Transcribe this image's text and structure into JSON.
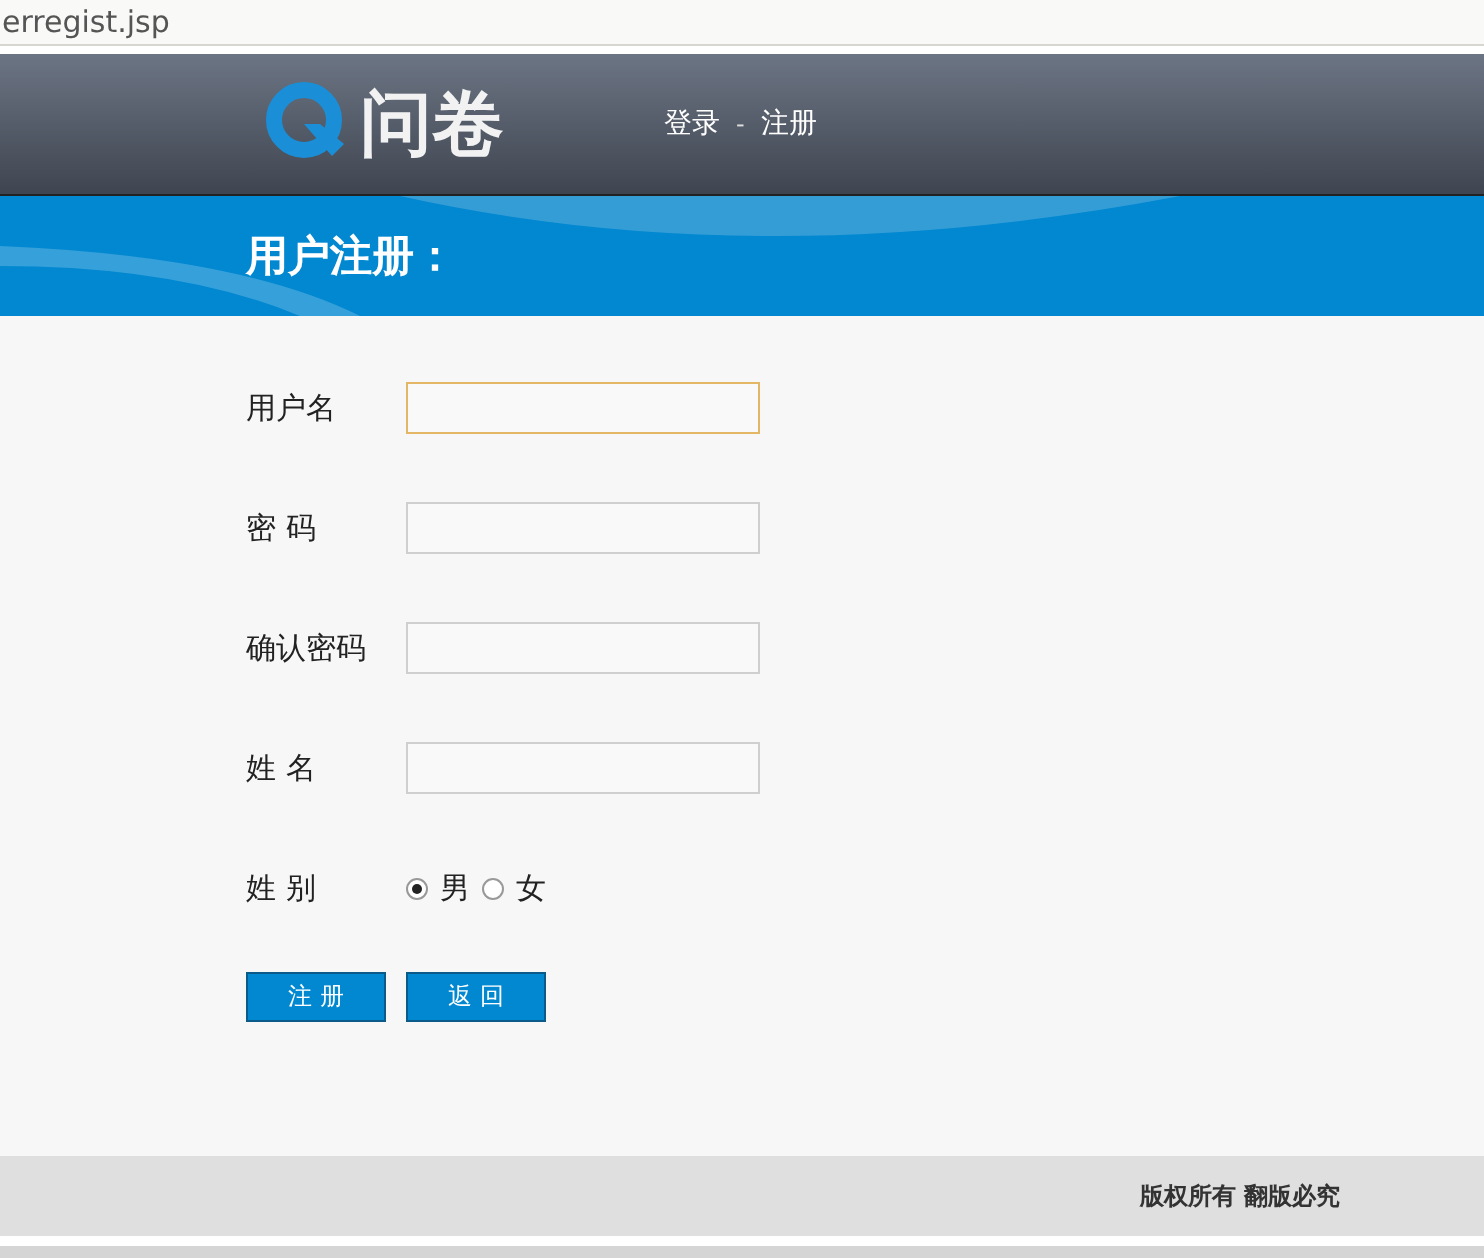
{
  "address_bar": {
    "url": "erregist.jsp"
  },
  "header": {
    "logo_text": "问卷",
    "nav": [
      {
        "label": "登录"
      },
      {
        "label": "注册"
      }
    ],
    "nav_separator": "-"
  },
  "banner": {
    "title": "用户注册："
  },
  "form": {
    "fields": [
      {
        "kind": "text",
        "label": "用户名",
        "focused": true
      },
      {
        "kind": "text",
        "label": "密 码",
        "focused": false
      },
      {
        "kind": "text",
        "label": "确认密码",
        "focused": false
      },
      {
        "kind": "text",
        "label": "姓 名",
        "focused": false
      },
      {
        "kind": "radio",
        "label": "姓 别",
        "options": [
          {
            "label": "男",
            "selected": true
          },
          {
            "label": "女",
            "selected": false
          }
        ]
      }
    ],
    "buttons": [
      {
        "label": "注 册"
      },
      {
        "label": "返 回"
      }
    ]
  },
  "footer": {
    "text": "版权所有 翻版必究"
  }
}
